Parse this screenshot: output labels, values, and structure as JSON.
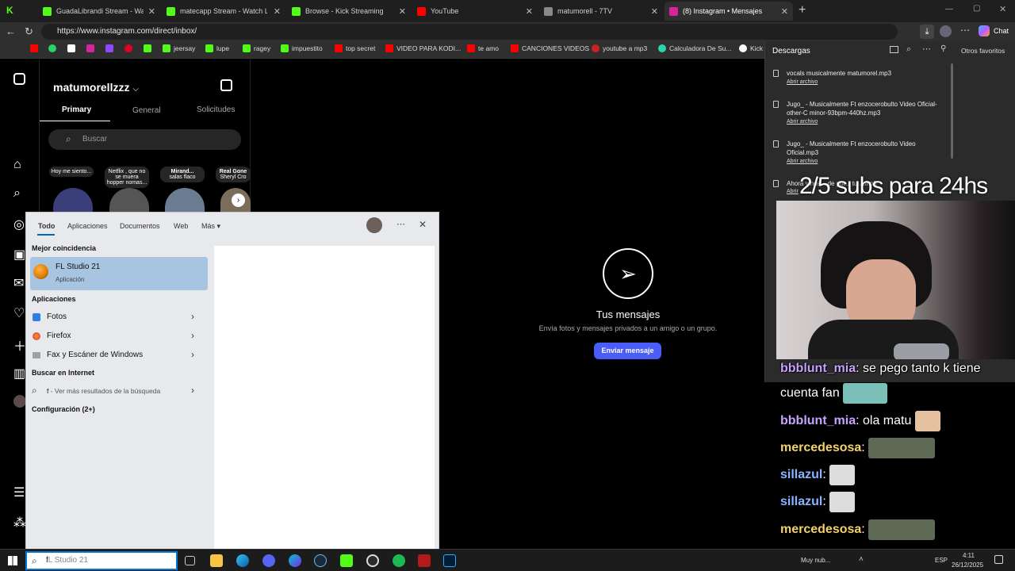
{
  "browser": {
    "tabs": [
      {
        "title": "GuadaLibrandi Stream - Watch",
        "color": "#53fc18"
      },
      {
        "title": "matecapp Stream - Watch Live on",
        "color": "#53fc18"
      },
      {
        "title": "Browse - Kick Streaming",
        "color": "#53fc18"
      },
      {
        "title": "YouTube",
        "color": "#ff0000"
      },
      {
        "title": "matumorell - 7TV",
        "color": "#888888"
      },
      {
        "title": "(8) Instagram • Mensajes",
        "color": "#d6249f"
      }
    ],
    "new_tab": "+",
    "chat_label": "Chat",
    "url": "https://www.instagram.com/direct/inbox/",
    "bookmarks": [
      {
        "label": "",
        "color": "#ff0000"
      },
      {
        "label": "",
        "color": "#25d366"
      },
      {
        "label": "",
        "color": "#ffffff"
      },
      {
        "label": "",
        "color": "#d6249f"
      },
      {
        "label": "",
        "color": "#9146ff"
      },
      {
        "label": "",
        "color": "#e60023"
      },
      {
        "label": "",
        "color": "#53fc18"
      },
      {
        "label": "jeersay",
        "color": "#53fc18"
      },
      {
        "label": "lupe",
        "color": "#53fc18"
      },
      {
        "label": "ragey",
        "color": "#53fc18"
      },
      {
        "label": "impuestito",
        "color": "#53fc18"
      },
      {
        "label": "top secret",
        "color": "#ff0000"
      },
      {
        "label": "VIDEO PARA KODI...",
        "color": "#ff0000"
      },
      {
        "label": "te amo",
        "color": "#ff0000"
      },
      {
        "label": "CANCIONES VIDEOS",
        "color": "#ff0000"
      },
      {
        "label": "youtube a mp3",
        "color": "#cc2222"
      },
      {
        "label": "Calculadora De Su...",
        "color": "#2bd4a8"
      },
      {
        "label": "Kick",
        "color": "#ffffff"
      }
    ],
    "other_favorites": "Otros favoritos"
  },
  "instagram": {
    "username": "matumorellzzz",
    "tabs": [
      "Primary",
      "General",
      "Solicitudes"
    ],
    "search_placeholder": "Buscar",
    "stories": [
      {
        "text": "Hoy me siento..."
      },
      {
        "text": "Netflix , que no se muera hopper nomas..."
      },
      {
        "name": "Mirand...",
        "text": "salas flaco"
      },
      {
        "name": "Real Gone",
        "text": "Sheryl Cro"
      }
    ],
    "main_title": "Tus mensajes",
    "main_subtitle": "Envía fotos y mensajes privados a un amigo o un grupo.",
    "send_button": "Enviar mensaje"
  },
  "downloads": {
    "title": "Descargas",
    "items": [
      {
        "name": "vocals musicalmente matumorel.mp3",
        "action": "Abrir archivo"
      },
      {
        "name": "Jugo_ - Musicalmente Ft enzocerobulto Video Oficial-other-C minor-93bpm-440hz.mp3",
        "action": "Abrir archivo"
      },
      {
        "name": "Jugo_ - Musicalmente Ft enzocerobulto Video Oficial.mp3",
        "action": "Abrir archivo"
      },
      {
        "name": "Ahora y nos... de por... tu ...mp3",
        "action": "Abrir"
      }
    ]
  },
  "search_panel": {
    "tabs": [
      "Todo",
      "Aplicaciones",
      "Documentos",
      "Web",
      "Más"
    ],
    "best_match_label": "Mejor coincidencia",
    "best_match": {
      "name": "FL Studio 21",
      "type": "Aplicación"
    },
    "apps_label": "Aplicaciones",
    "apps": [
      "Fotos",
      "Firefox",
      "Fax y Escáner de Windows"
    ],
    "web_label": "Buscar en Internet",
    "web_item": {
      "query": "f",
      "suffix": " - Ver más resultados de la búsqueda"
    },
    "settings_label": "Configuración (2+)"
  },
  "overlay_text": "2/5 subs para 24hs",
  "chat": [
    {
      "user": "bbblunt_mia",
      "color": "#c8a2ff",
      "message": ": se pego tanto k tiene"
    },
    {
      "user": "",
      "color": "#ffffff",
      "message": "cuenta fan"
    },
    {
      "user": "bbblunt_mia",
      "color": "#c8a2ff",
      "message": ": ola matu"
    },
    {
      "user": "mercedesosa",
      "color": "#f2d26b",
      "message": ":"
    },
    {
      "user": "sillazul",
      "color": "#8ab4ff",
      "message": ":"
    },
    {
      "user": "sillazul",
      "color": "#8ab4ff",
      "message": ":"
    },
    {
      "user": "mercedesosa",
      "color": "#f2d26b",
      "message": ":"
    },
    {
      "user": "sillazul",
      "color": "#8ab4ff",
      "message": ":"
    }
  ],
  "taskbar": {
    "search_typed": "f",
    "search_suggest": "L Studio 21",
    "language": "ESP",
    "time": "4:11",
    "date": "26/12/2025",
    "weather": "Muy nub..."
  }
}
